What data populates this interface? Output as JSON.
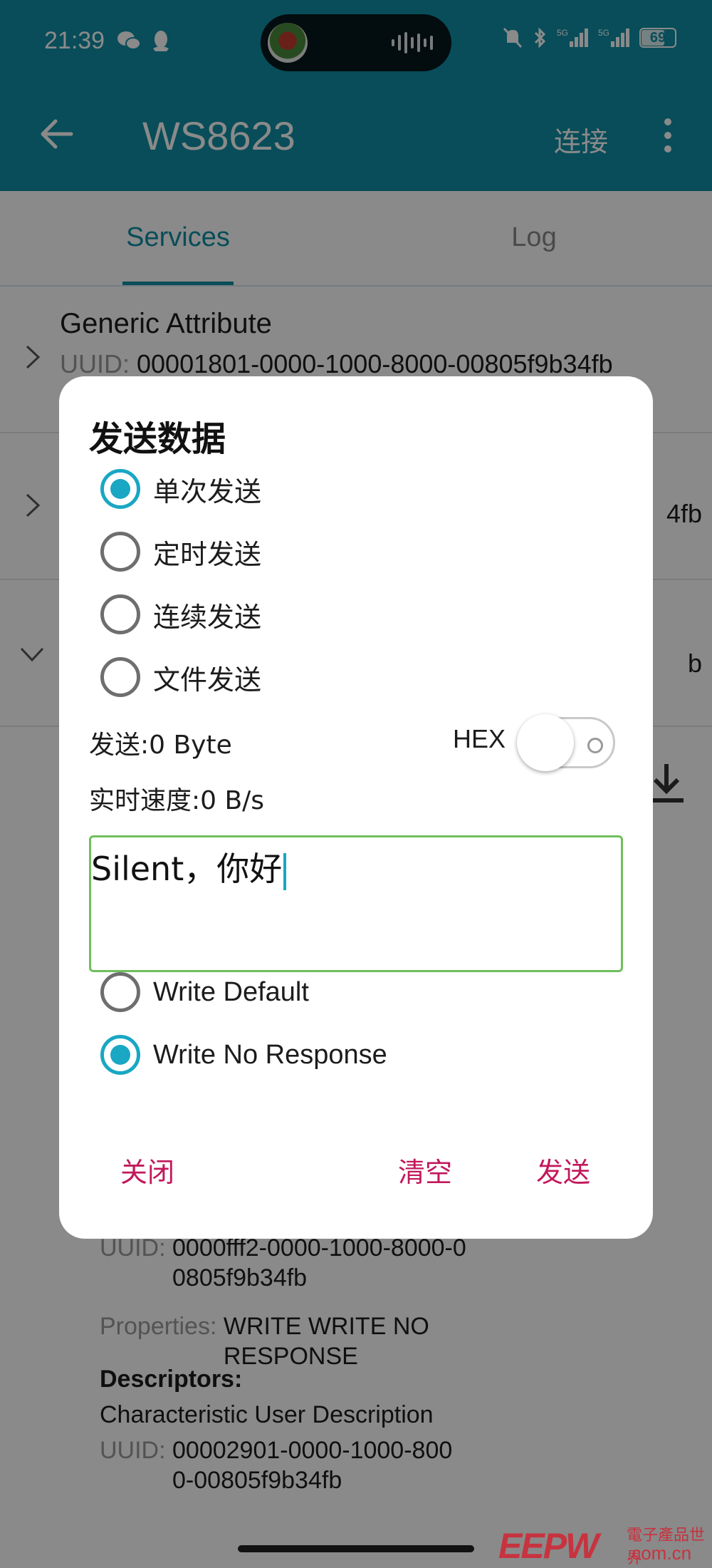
{
  "status_bar": {
    "time": "21:39",
    "battery": "69",
    "left_icons": [
      "wechat-icon",
      "qq-icon"
    ],
    "right_icons": [
      "mute-icon",
      "bluetooth-icon",
      "5g-signal-icon",
      "5g-signal-icon",
      "battery-icon"
    ]
  },
  "app_bar": {
    "title": "WS8623",
    "connect_label": "连接",
    "back_icon": "arrow-back-icon",
    "more_icon": "more-vert-icon"
  },
  "tabs": [
    {
      "label": "Services",
      "active": true
    },
    {
      "label": "Log",
      "active": false
    }
  ],
  "services": [
    {
      "name": "Generic Attribute",
      "uuid_label": "UUID:",
      "uuid": "00001801-0000-1000-8000-00805f9b34fb"
    },
    {
      "tail": "4fb"
    },
    {
      "tail": "b"
    }
  ],
  "characteristic": {
    "uuid_label": "UUID:",
    "uuid_line1": "0000fff2-0000-1000-8000-0",
    "uuid_line2": "0805f9b34fb",
    "properties_label": "Properties:",
    "properties_line1": "WRITE WRITE NO",
    "properties_line2": "RESPONSE",
    "descriptors_heading": "Descriptors:",
    "descriptor_name": "Characteristic User Description",
    "descriptor_uuid_label": "UUID:",
    "descriptor_uuid_line1": "00002901-0000-1000-800",
    "descriptor_uuid_line2": "0-00805f9b34fb"
  },
  "dialog": {
    "title": "发送数据",
    "send_modes": [
      {
        "label": "单次发送",
        "selected": true
      },
      {
        "label": "定时发送",
        "selected": false
      },
      {
        "label": "连续发送",
        "selected": false
      },
      {
        "label": "文件发送",
        "selected": false
      }
    ],
    "sent_count": "发送:0 Byte",
    "hex_label": "HEX",
    "hex_enabled": false,
    "speed": "实时速度:0 B/s",
    "input_value": "Silent，你好",
    "write_modes": [
      {
        "label": "Write Default",
        "selected": false
      },
      {
        "label": "Write No Response",
        "selected": true
      }
    ],
    "actions": {
      "close": "关闭",
      "clear": "清空",
      "send": "发送"
    },
    "accent_color": "#19a7c3",
    "action_color": "#c2185b"
  },
  "watermark": {
    "logo": "EEPW",
    "chinese": "電子產品世界",
    "domain": ".com.cn"
  },
  "colors": {
    "primary": "#0f8ea4",
    "input_border": "#6fbf5b"
  }
}
